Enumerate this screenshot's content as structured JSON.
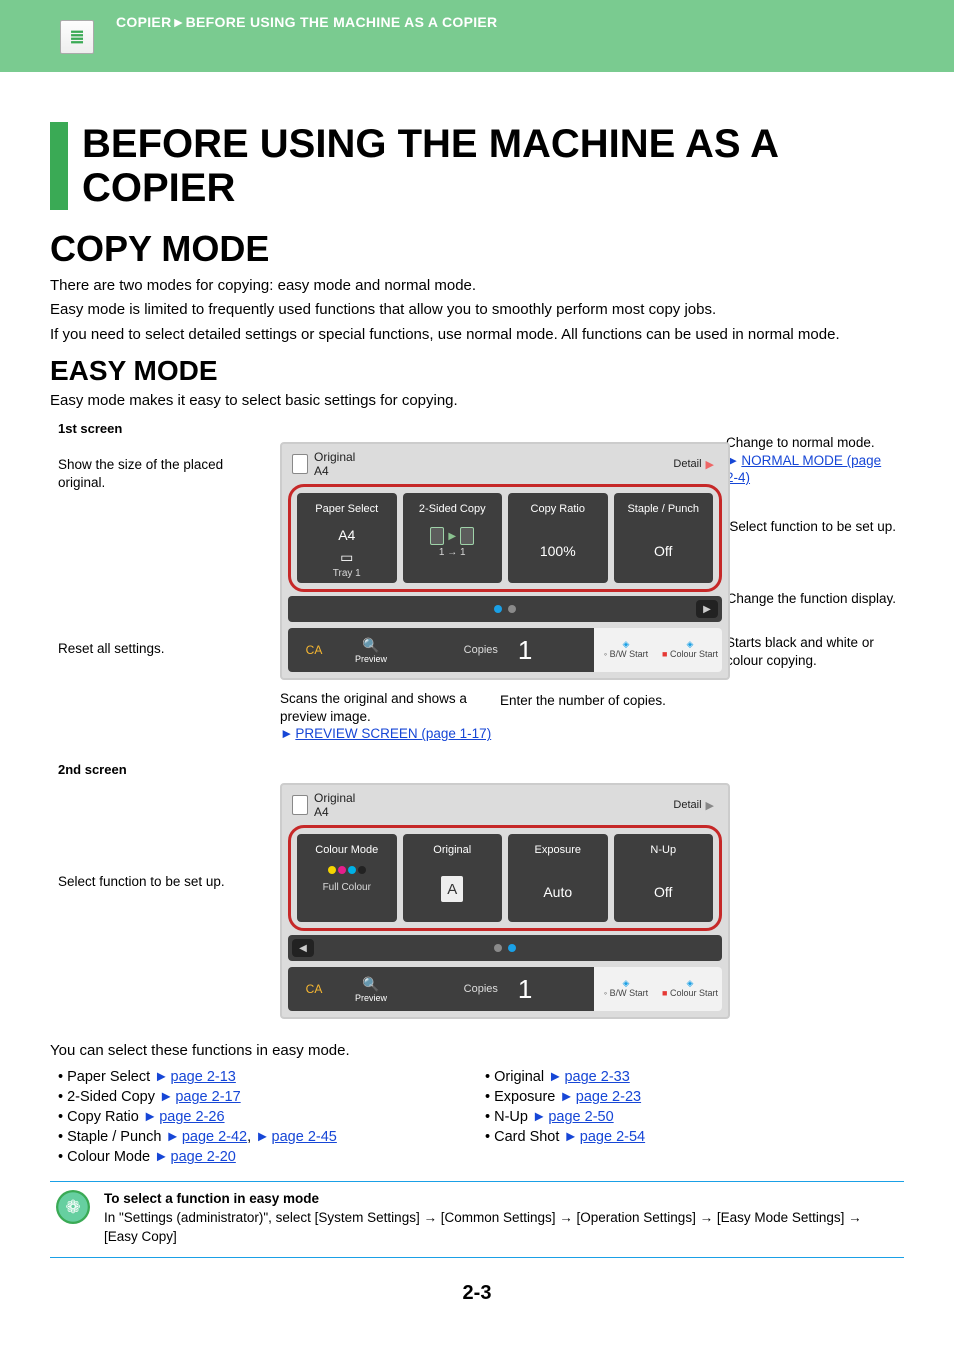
{
  "header": {
    "breadcrumb": "COPIER►BEFORE USING THE MACHINE AS A COPIER"
  },
  "title": "BEFORE USING THE MACHINE AS A COPIER",
  "copy_mode": {
    "heading": "COPY MODE",
    "p1": "There are two modes for copying: easy mode and normal mode.",
    "p2": "Easy mode is limited to frequently used functions that allow you to smoothly perform most copy jobs.",
    "p3": "If you need to select detailed settings or special functions, use normal mode. All functions can be used in normal mode."
  },
  "easy_mode": {
    "heading": "EASY MODE",
    "intro": "Easy mode makes it easy to select basic settings for copying."
  },
  "screen1": {
    "label": "1st screen",
    "note_show_size": "Show the size of the placed original.",
    "note_reset": "Reset all settings.",
    "note_change_normal": "Change to normal mode.",
    "link_normal_mode": "NORMAL MODE (page 2-4)",
    "note_select_fn": "Select function to be set up.",
    "note_change_display": "Change the function display.",
    "note_start": "Starts black and white or colour copying.",
    "note_scan": "Scans the original and shows a preview image.",
    "link_preview": "PREVIEW SCREEN (page 1-17)",
    "note_enter_copies": "Enter the number of copies.",
    "panel": {
      "original_label": "Original",
      "original_size": "A4",
      "detail": "Detail",
      "tile1": {
        "label": "Paper Select",
        "v1": "A4",
        "v2": "Tray 1"
      },
      "tile2": {
        "label": "2-Sided Copy",
        "val": "1 → 1"
      },
      "tile3": {
        "label": "Copy Ratio",
        "val": "100%"
      },
      "tile4": {
        "label": "Staple / Punch",
        "val": "Off"
      },
      "ca": "CA",
      "preview": "Preview",
      "copies_label": "Copies",
      "copies_val": "1",
      "bw": "B/W Start",
      "colour": "Colour Start"
    }
  },
  "screen2": {
    "label": "2nd screen",
    "note_select_fn": "Select function to be set up.",
    "panel": {
      "original_label": "Original",
      "original_size": "A4",
      "detail": "Detail",
      "tile1": {
        "label": "Colour Mode",
        "val": "Full Colour"
      },
      "tile2": {
        "label": "Original",
        "val": "A"
      },
      "tile3": {
        "label": "Exposure",
        "val": "Auto"
      },
      "tile4": {
        "label": "N-Up",
        "val": "Off"
      },
      "ca": "CA",
      "preview": "Preview",
      "copies_label": "Copies",
      "copies_val": "1",
      "bw": "B/W Start",
      "colour": "Colour Start"
    }
  },
  "functions_intro": "You can select these functions in easy mode.",
  "fn_left": [
    {
      "name": "Paper Select ",
      "link": "page 2-13"
    },
    {
      "name": "2-Sided Copy ",
      "link": "page 2-17"
    },
    {
      "name": "Copy Ratio ",
      "link": "page 2-26"
    },
    {
      "name": "Staple / Punch ",
      "link": "page 2-42",
      "link2": "page 2-45"
    },
    {
      "name": "Colour Mode ",
      "link": "page 2-20"
    }
  ],
  "fn_right": [
    {
      "name": "Original ",
      "link": "page 2-33"
    },
    {
      "name": "Exposure ",
      "link": "page 2-23"
    },
    {
      "name": "N-Up ",
      "link": "page 2-50"
    },
    {
      "name": "Card Shot ",
      "link": "page 2-54"
    }
  ],
  "info": {
    "title": "To select a function in easy mode",
    "body": "In \"Settings (administrator)\", select [System Settings] → [Common Settings] → [Operation Settings] → [Easy Mode Settings] → [Easy Copy]"
  },
  "page_number": "2-3"
}
